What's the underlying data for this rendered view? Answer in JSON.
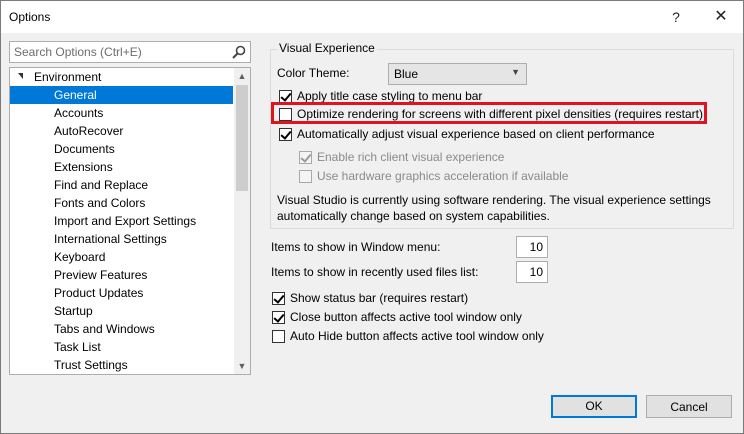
{
  "window": {
    "title": "Options",
    "help_glyph": "?",
    "close_glyph": "✕"
  },
  "search": {
    "placeholder": "Search Options (Ctrl+E)"
  },
  "tree": {
    "root": "Environment",
    "items": [
      "General",
      "Accounts",
      "AutoRecover",
      "Documents",
      "Extensions",
      "Find and Replace",
      "Fonts and Colors",
      "Import and Export Settings",
      "International Settings",
      "Keyboard",
      "Preview Features",
      "Product Updates",
      "Startup",
      "Tabs and Windows",
      "Task List",
      "Trust Settings"
    ],
    "selected": "General"
  },
  "visual": {
    "group_title": "Visual Experience",
    "color_theme_label": "Color Theme:",
    "color_theme_value": "Blue",
    "options": [
      {
        "label": "Apply title case styling to menu bar",
        "checked": true,
        "enabled": true
      },
      {
        "label": "Optimize rendering for screens with different pixel densities (requires restart)",
        "checked": false,
        "enabled": true
      },
      {
        "label": "Automatically adjust visual experience based on client performance",
        "checked": true,
        "enabled": true
      },
      {
        "label": "Enable rich client visual experience",
        "checked": true,
        "enabled": false
      },
      {
        "label": "Use hardware graphics acceleration if available",
        "checked": false,
        "enabled": false
      }
    ],
    "info": "Visual Studio is currently using software rendering.  The visual experience settings automatically change based on system capabilities."
  },
  "window_menu": {
    "label": "Items to show in Window menu:",
    "value": "10"
  },
  "recent_files": {
    "label": "Items to show in recently used files list:",
    "value": "10"
  },
  "bottom_options": [
    {
      "label": "Show status bar (requires restart)",
      "checked": true
    },
    {
      "label": "Close button affects active tool window only",
      "checked": true
    },
    {
      "label": "Auto Hide button affects active tool window only",
      "checked": false
    }
  ],
  "buttons": {
    "ok": "OK",
    "cancel": "Cancel"
  },
  "colors": {
    "accent": "#0078d7",
    "highlight": "#e0141e"
  }
}
